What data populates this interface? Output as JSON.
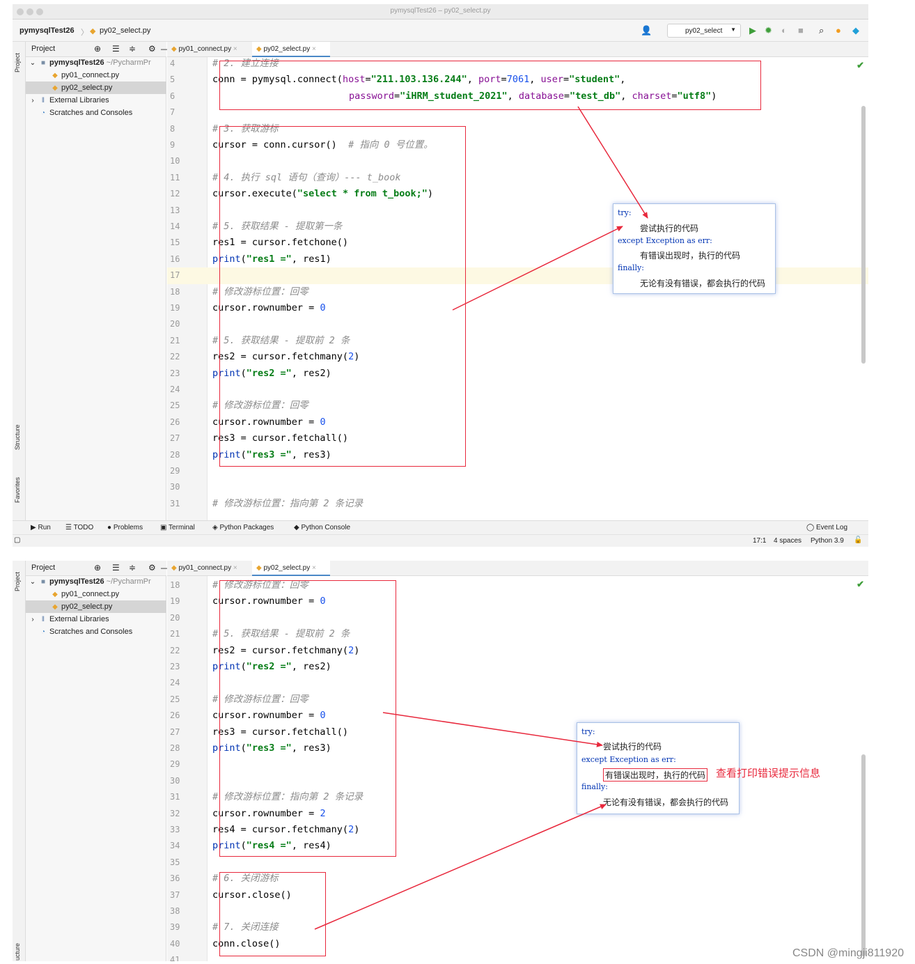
{
  "window": {
    "title": "pymysqlTest26 – py02_select.py"
  },
  "navbar": {
    "project_crumb": "pymysqlTest26",
    "file_crumb": "py02_select.py",
    "run_config": "py02_select"
  },
  "sidebar_tabs": {
    "project": "Project",
    "structure": "Structure",
    "favorites": "Favorites",
    "structure_cut": "ucture"
  },
  "project_panel": {
    "header": "Project",
    "root_name": "pymysqlTest26",
    "root_path": "~/PycharmPr",
    "files": [
      "py01_connect.py",
      "py02_select.py"
    ],
    "external": "External Libraries",
    "scratches": "Scratches and Consoles"
  },
  "tabs": [
    "py01_connect.py",
    "py02_select.py"
  ],
  "panel1_lines": [
    {
      "n": "4"
    },
    {
      "n": "5"
    },
    {
      "n": "6"
    },
    {
      "n": "7"
    },
    {
      "n": "8"
    },
    {
      "n": "9"
    },
    {
      "n": "10"
    },
    {
      "n": "11"
    },
    {
      "n": "12"
    },
    {
      "n": "13"
    },
    {
      "n": "14"
    },
    {
      "n": "15"
    },
    {
      "n": "16"
    },
    {
      "n": "17"
    },
    {
      "n": "18"
    },
    {
      "n": "19"
    },
    {
      "n": "20"
    },
    {
      "n": "21"
    },
    {
      "n": "22"
    },
    {
      "n": "23"
    },
    {
      "n": "24"
    },
    {
      "n": "25"
    },
    {
      "n": "26"
    },
    {
      "n": "27"
    },
    {
      "n": "28"
    },
    {
      "n": "29"
    },
    {
      "n": "30"
    },
    {
      "n": "31"
    }
  ],
  "panel2_lines": [
    {
      "n": "18"
    },
    {
      "n": "19"
    },
    {
      "n": "20"
    },
    {
      "n": "21"
    },
    {
      "n": "22"
    },
    {
      "n": "23"
    },
    {
      "n": "24"
    },
    {
      "n": "25"
    },
    {
      "n": "26"
    },
    {
      "n": "27"
    },
    {
      "n": "28"
    },
    {
      "n": "29"
    },
    {
      "n": "30"
    },
    {
      "n": "31"
    },
    {
      "n": "32"
    },
    {
      "n": "33"
    },
    {
      "n": "34"
    },
    {
      "n": "35"
    },
    {
      "n": "36"
    },
    {
      "n": "37"
    },
    {
      "n": "38"
    },
    {
      "n": "39"
    },
    {
      "n": "40"
    },
    {
      "n": "41"
    }
  ],
  "code": {
    "c2": "# 2. 建立连接",
    "connect_a": "conn = pymysql.connect(",
    "host_k": "host",
    "host_v": "\"211.103.136.244\"",
    "port_k": "port",
    "port_v": "7061",
    "user_k": "user",
    "user_v": "\"student\"",
    "pwd_k": "password",
    "pwd_v": "\"iHRM_student_2021\"",
    "db_k": "database",
    "db_v": "\"test_db\"",
    "cs_k": "charset",
    "cs_v": "\"utf8\"",
    "c3": "# 3. 获取游标",
    "cursor_line": "cursor = conn.cursor()",
    "cursor_cm": "# 指向 0 号位置。",
    "c4": "# 4. 执行 sql 语句（查询）--- t_book",
    "exec_a": "cursor.execute(",
    "exec_s": "\"select * from t_book;\"",
    "exec_b": ")",
    "c5a": "# 5. 获取结果 - 提取第一条",
    "res1": "res1 = cursor.fetchone()",
    "print1_s": "\"res1 =\"",
    "print1_b": ", res1)",
    "c_reset": "# 修改游标位置：回零",
    "rownum0_a": "cursor.rownumber = ",
    "zero": "0",
    "c5b": "# 5. 获取结果 - 提取前 2 条",
    "res2_a": "res2 = cursor.fetchmany(",
    "two": "2",
    "close_p": ")",
    "print2_s": "\"res2 =\"",
    "print2_b": ", res2)",
    "res3": "res3 = cursor.fetchall()",
    "print3_s": "\"res3 =\"",
    "print3_b": ", res3)",
    "c_reset2": "# 修改游标位置：指向第 2 条记录",
    "res4_a": "res4 = cursor.fetchmany(",
    "print4_s": "\"res4 =\"",
    "print4_b": ", res4)",
    "c6": "# 6. 关闭游标",
    "cursor_close": "cursor.close()",
    "c7": "# 7. 关闭连接",
    "conn_close": "conn.close()",
    "print": "print"
  },
  "bottom_tools": [
    "Run",
    "TODO",
    "Problems",
    "Terminal",
    "Python Packages",
    "Python Console"
  ],
  "event_log": "Event Log",
  "status": {
    "position": "17:1",
    "indent": "4 spaces",
    "interpreter": "Python 3.9"
  },
  "popup": {
    "try": "try:",
    "try_body": "尝试执行的代码",
    "except": "except Exception as err:",
    "except_body": "有错误出现时，执行的代码",
    "finally": "finally:",
    "finally_body": "无论有没有错误，都会执行的代码"
  },
  "annotation": "查看打印错误提示信息",
  "watermark": "CSDN @mingji811920",
  "colors": {
    "annotation_red": "#e8283c",
    "keyword_blue": "#0033b3",
    "string_green": "#067d17",
    "number_blue": "#1750eb",
    "param_purple": "#871094"
  }
}
